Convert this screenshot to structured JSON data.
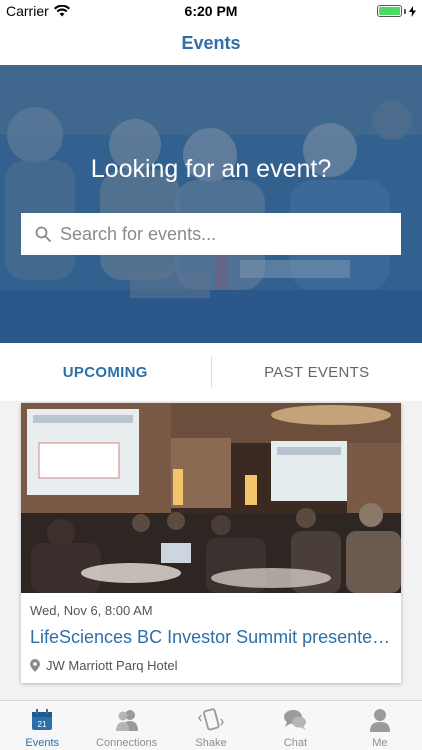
{
  "status_bar": {
    "carrier": "Carrier",
    "time": "6:20 PM",
    "battery_level": 1.0,
    "battery_color": "#4cd964"
  },
  "nav": {
    "title": "Events"
  },
  "hero": {
    "title": "Looking for an event?",
    "search_placeholder": "Search for events...",
    "search_icon": "search-icon",
    "overlay_color": "#2f5f93"
  },
  "tabs": {
    "upcoming_label": "UPCOMING",
    "past_label": "PAST EVENTS",
    "active": "upcoming"
  },
  "events": [
    {
      "date": "Wed, Nov 6, 8:00 AM",
      "title": "LifeSciences BC Investor Summit presented by",
      "venue": "JW Marriott Parq Hotel",
      "venue_icon": "location-pin-icon"
    }
  ],
  "tab_bar": {
    "items": [
      {
        "label": "Events",
        "icon": "calendar-icon",
        "calendar_day": "21",
        "active": true
      },
      {
        "label": "Connections",
        "icon": "people-icon",
        "active": false
      },
      {
        "label": "Shake",
        "icon": "shake-phone-icon",
        "active": false
      },
      {
        "label": "Chat",
        "icon": "chat-bubbles-icon",
        "active": false
      },
      {
        "label": "Me",
        "icon": "person-icon",
        "active": false
      }
    ]
  },
  "colors": {
    "accent": "#2d6fa8",
    "inactive": "#8e8e8e",
    "background": "#f2f2f2"
  }
}
